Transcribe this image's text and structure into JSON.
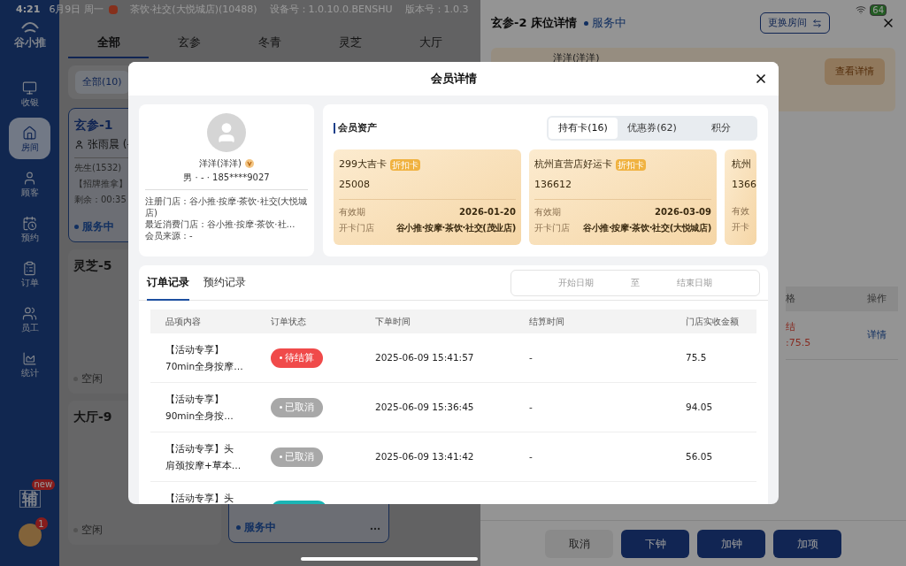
{
  "status_bar": {
    "time": "4:21",
    "date": "6月9日 周一",
    "store": "茶饮·社交(大悦城店)(10488)",
    "device": "设备号：1.0.10.0.BENSHU",
    "version": "版本号：1.0.3",
    "battery": "64"
  },
  "sidebar": {
    "logo": "谷小推",
    "items": [
      {
        "label": "收银",
        "selected": false
      },
      {
        "label": "房间",
        "selected": true
      },
      {
        "label": "顾客",
        "selected": false
      },
      {
        "label": "预约",
        "selected": false
      },
      {
        "label": "订单",
        "selected": false
      },
      {
        "label": "员工",
        "selected": false
      },
      {
        "label": "统计",
        "selected": false
      }
    ],
    "assistant": "辅",
    "assistant_badge": "new",
    "avatar_badge": "1"
  },
  "room_tabs": [
    {
      "label": "全部",
      "selected": true
    },
    {
      "label": "玄参",
      "selected": false
    },
    {
      "label": "冬青",
      "selected": false
    },
    {
      "label": "灵芝",
      "selected": false
    },
    {
      "label": "大厅",
      "selected": false
    }
  ],
  "filter": "全部(10)",
  "rooms": [
    {
      "name": "玄参-1",
      "kind": "busy",
      "customer": "张雨晨 (-",
      "lines": [
        "先生(1532)",
        "【招牌推拿】",
        "剩余：00:35"
      ],
      "status": "服务中"
    },
    {
      "name": "灵芝-5",
      "kind": "idle",
      "status": "空闲"
    },
    {
      "name": "大厅-9",
      "kind": "idle",
      "status": "空闲"
    }
  ],
  "room_partial": {
    "kind": "busy",
    "status": "服务中"
  },
  "drawer": {
    "title": "玄参-2 床位详情",
    "status": "服务中",
    "switch_button": "更换房间",
    "member_name": "洋洋(洋洋)",
    "detail_button": "查看详情",
    "columns": [
      "格",
      "操作"
    ],
    "row": {
      "status": "结",
      "amount": ":75.5",
      "action": "详情"
    },
    "buttons": [
      {
        "label": "取消",
        "kind": "secondary"
      },
      {
        "label": "下钟",
        "kind": "primary"
      },
      {
        "label": "加钟",
        "kind": "primary"
      },
      {
        "label": "加项",
        "kind": "primary"
      }
    ]
  },
  "modal": {
    "title": "会员详情",
    "profile": {
      "name": "洋洋(洋洋)",
      "info": "男 · - · 185****9027",
      "lines": [
        "注册门店：谷小推·按摩·茶饮·社交(大悦城店)",
        "最近消费门店：谷小推·按摩·茶饮·社…",
        "会员来源：-"
      ]
    },
    "assets": {
      "title": "会员资产",
      "tabs": [
        {
          "label": "持有卡(16)",
          "selected": true
        },
        {
          "label": "优惠券(62)",
          "selected": false
        },
        {
          "label": "积分",
          "selected": false
        }
      ],
      "cards": [
        {
          "name": "299大吉卡",
          "tag": "折扣卡",
          "number": "25008",
          "expiry_label": "有效期",
          "expiry": "2026-01-20",
          "store_label": "开卡门店",
          "store": "谷小推·按摩·茶饮·社交(茂业店)"
        },
        {
          "name": "杭州直营店好运卡",
          "tag": "折扣卡",
          "number": "136612",
          "expiry_label": "有效期",
          "expiry": "2026-03-09",
          "store_label": "开卡门店",
          "store": "谷小推·按摩·茶饮·社交(大悦城店)"
        },
        {
          "name": "杭州",
          "number": "1366",
          "expiry_label": "有效",
          "store_label": "开卡"
        }
      ]
    },
    "orders": {
      "tabs": [
        {
          "label": "订单记录",
          "selected": true
        },
        {
          "label": "预约记录",
          "selected": false
        }
      ],
      "date_start": "开始日期",
      "date_sep": "至",
      "date_end": "结束日期",
      "columns": [
        "品项内容",
        "订单状态",
        "下单时间",
        "结算时间",
        "门店实收金额"
      ],
      "rows": [
        {
          "item": [
            "【活动专享】",
            "70min全身按摩…"
          ],
          "status": {
            "label": "待结算",
            "color": "#f04a4a"
          },
          "created": "2025-06-09 15:41:57",
          "settled": "-",
          "amount": "75.5"
        },
        {
          "item": [
            "【活动专享】",
            "90min全身按…"
          ],
          "status": {
            "label": "已取消",
            "color": "#a8a8a8"
          },
          "created": "2025-06-09 15:36:45",
          "settled": "-",
          "amount": "94.05"
        },
        {
          "item": [
            "【活动专享】头",
            "肩颈按摩+草本…"
          ],
          "status": {
            "label": "已取消",
            "color": "#a8a8a8"
          },
          "created": "2025-06-09 13:41:42",
          "settled": "-",
          "amount": "56.05"
        },
        {
          "item": [
            "【活动专享】头"
          ],
          "status": {
            "color": "#1bb5b5"
          }
        }
      ]
    }
  }
}
